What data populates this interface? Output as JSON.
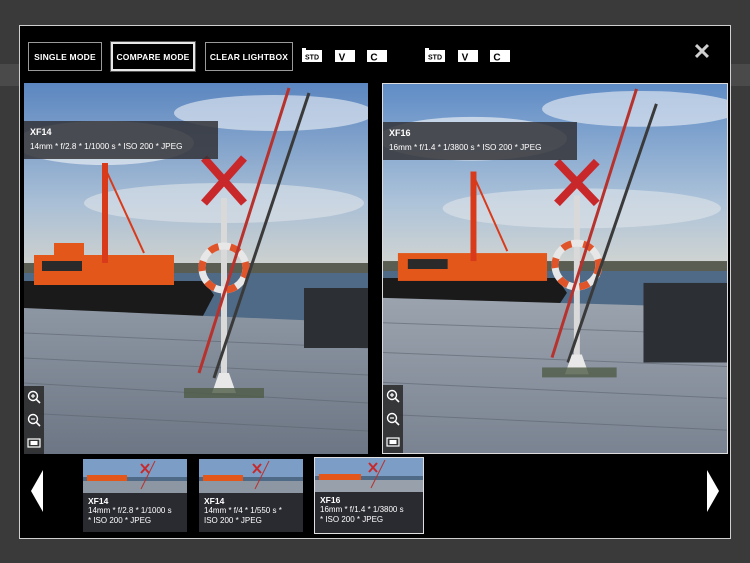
{
  "toolbar": {
    "single_mode": "SINGLE MODE",
    "compare_mode": "COMPARE MODE",
    "clear_lightbox": "CLEAR LIGHTBOX",
    "left_icons": [
      "STD",
      "V",
      "C"
    ],
    "right_icons": [
      "STD",
      "V",
      "C"
    ]
  },
  "left_image": {
    "lens": "XF14",
    "specs": "14mm * f/2.8 * 1/1000 s * ISO 200 * JPEG"
  },
  "right_image": {
    "lens": "XF16",
    "specs": "16mm * f/1.4 * 1/3800 s * ISO 200 * JPEG"
  },
  "thumbnails": [
    {
      "lens": "XF14",
      "line1": "14mm * f/2.8 * 1/1000 s",
      "line2": "* ISO 200 * JPEG"
    },
    {
      "lens": "XF14",
      "line1": "14mm * f/4 * 1/550 s *",
      "line2": "ISO 200 * JPEG"
    },
    {
      "lens": "XF16",
      "line1": "16mm * f/1.4 * 1/3800 s",
      "line2": "* ISO 200 * JPEG"
    }
  ],
  "colors": {
    "accent": "#ffffff",
    "background": "#000000",
    "border": "#cfcfcf"
  }
}
